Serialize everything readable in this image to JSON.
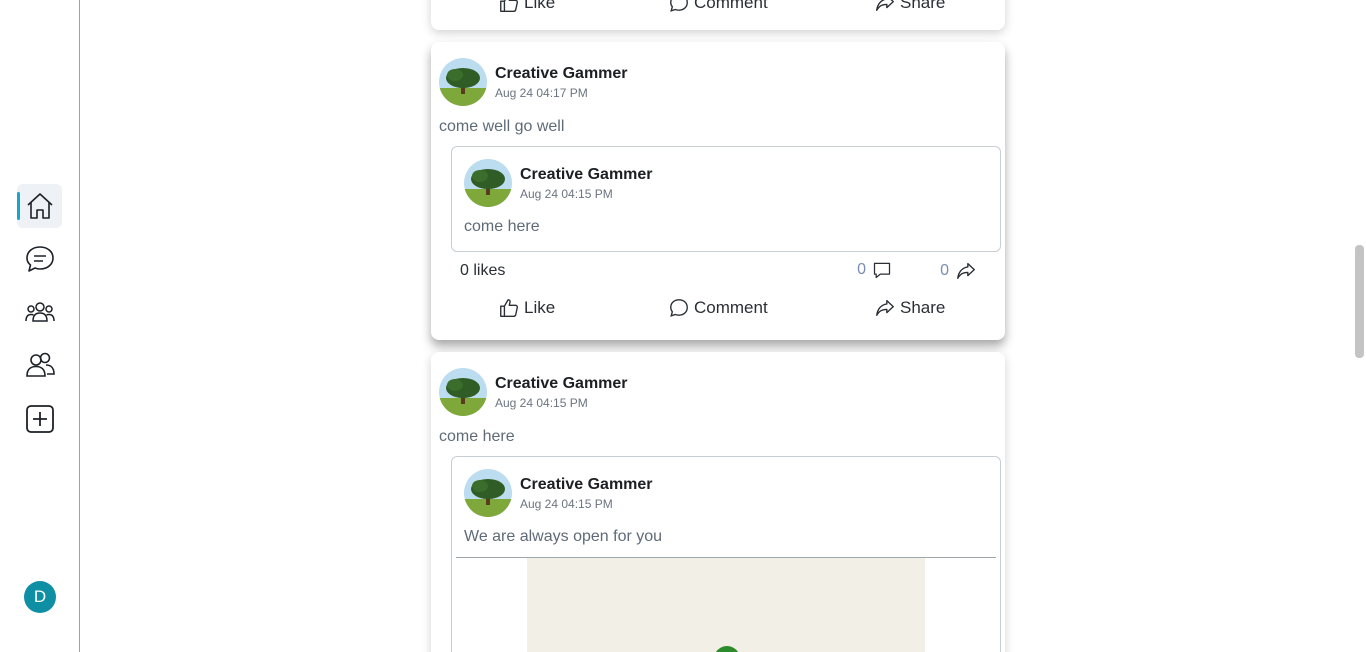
{
  "sidebar": {
    "nav": [
      {
        "icon": "home-icon",
        "active": true
      },
      {
        "icon": "chat-bubbles-icon",
        "active": false
      },
      {
        "icon": "community-icon",
        "active": false
      },
      {
        "icon": "friends-icon",
        "active": false
      },
      {
        "icon": "add-post-icon",
        "active": false
      }
    ],
    "user_initial": "D"
  },
  "top_card": {
    "actions": {
      "like": "Like",
      "comment": "Comment",
      "share": "Share"
    }
  },
  "post_1": {
    "author": "Creative Gammer",
    "time": "Aug 24 04:17 PM",
    "text": "come well go well",
    "shared": {
      "author": "Creative Gammer",
      "time": "Aug 24 04:15 PM",
      "text": "come here"
    },
    "likes": "0 likes",
    "comments_count": "0",
    "shares_count": "0",
    "actions": {
      "like": "Like",
      "comment": "Comment",
      "share": "Share"
    }
  },
  "post_2": {
    "author": "Creative Gammer",
    "time": "Aug 24 04:15 PM",
    "text": "come here",
    "shared": {
      "author": "Creative Gammer",
      "time": "Aug 24 04:15 PM",
      "text": "We are always open for you"
    }
  },
  "colors": {
    "accent": "#16a6c9",
    "avatar_bg": "#0e8fa4",
    "count_text": "#7b8db3"
  }
}
